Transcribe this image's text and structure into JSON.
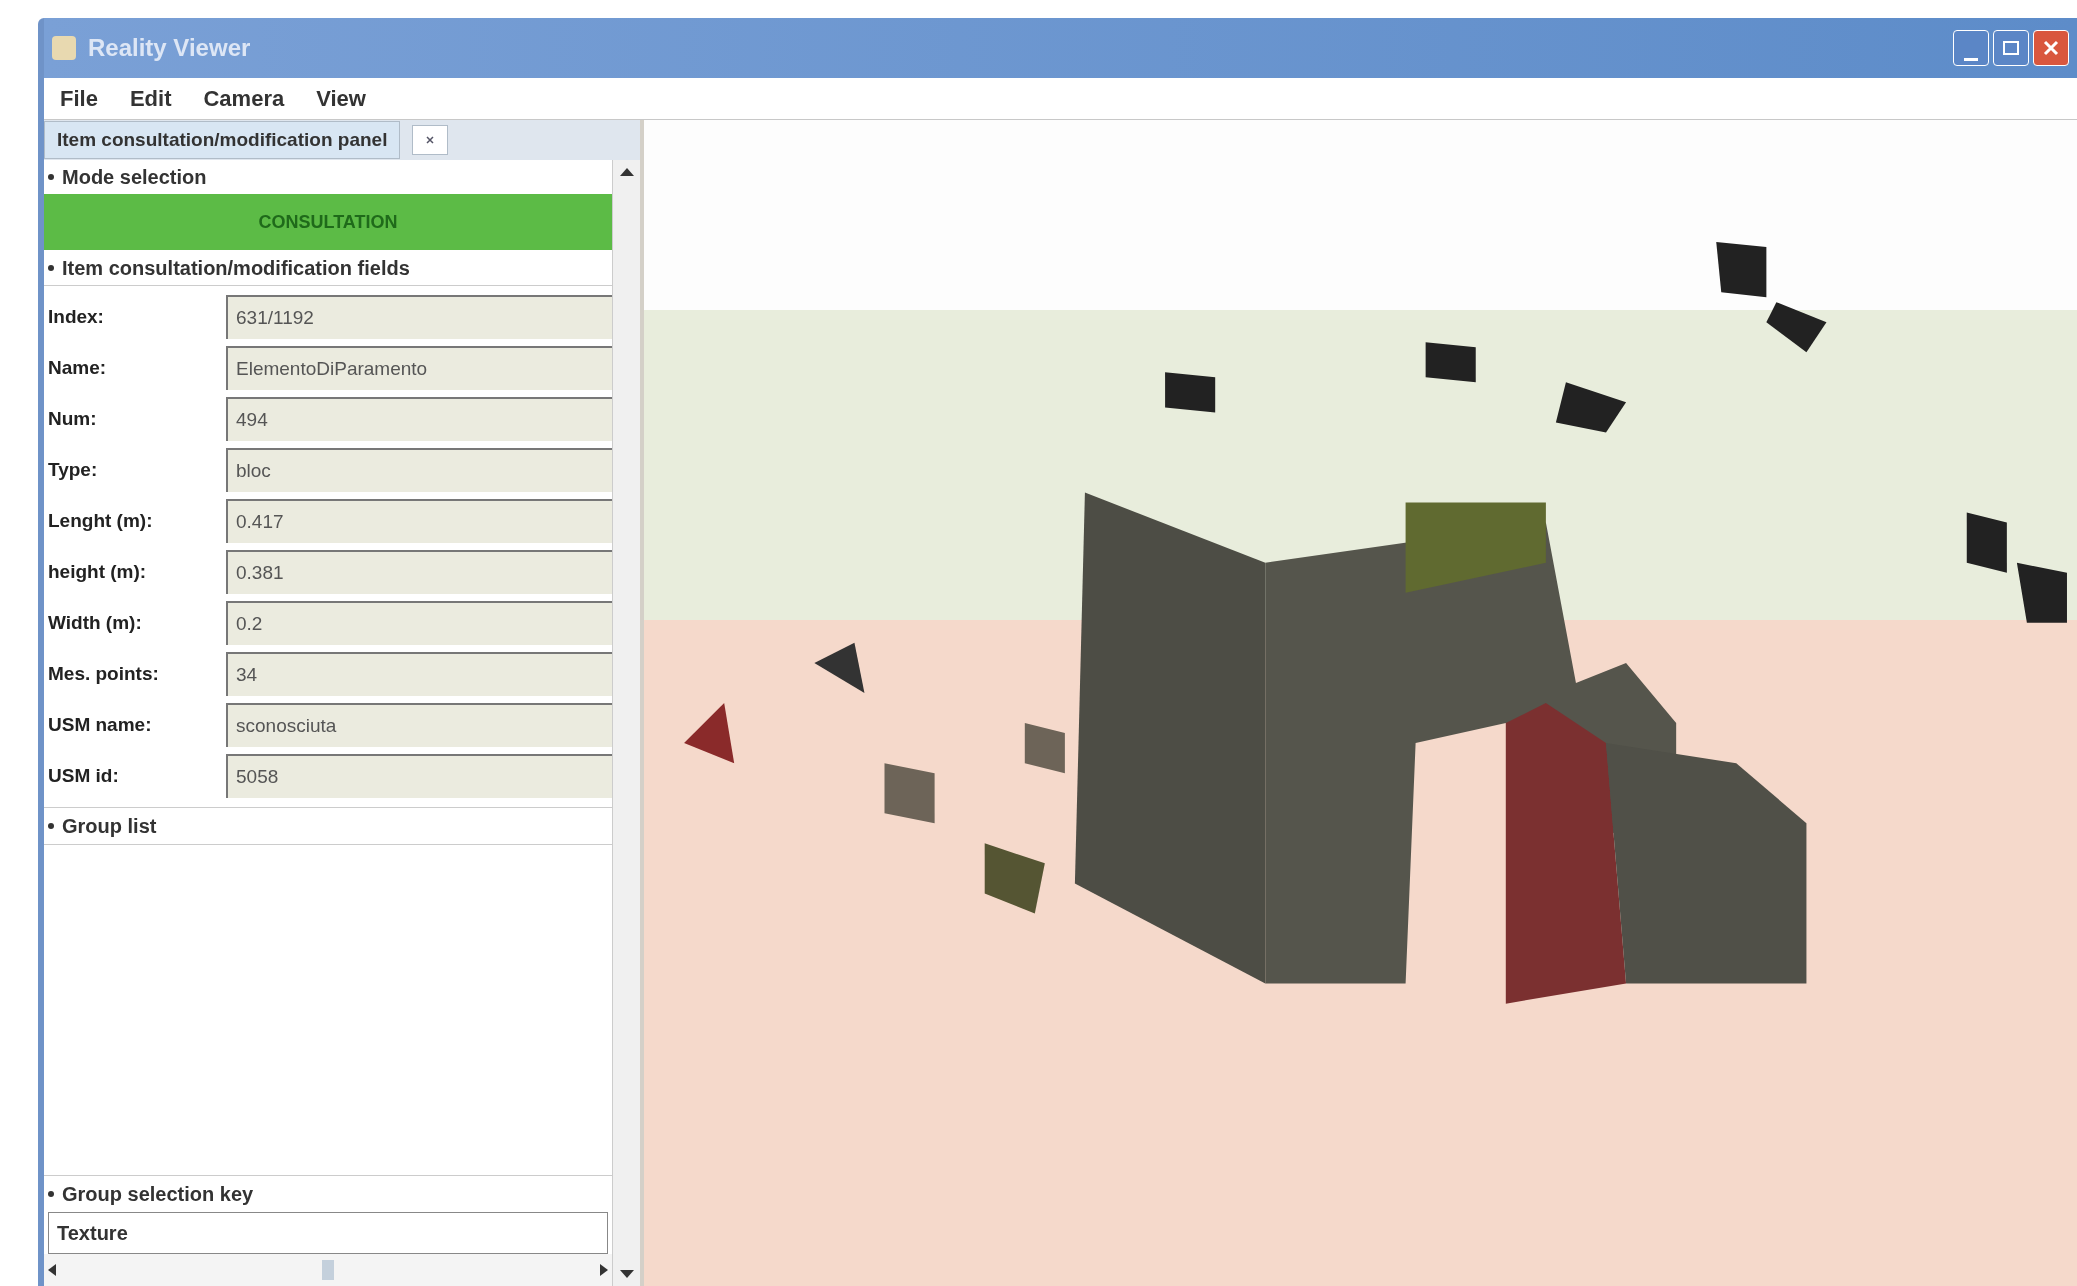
{
  "window": {
    "title": "Reality Viewer"
  },
  "menu": [
    {
      "label": "File",
      "selected": false
    },
    {
      "label": "Edit",
      "selected": false
    },
    {
      "label": "Camera",
      "selected": false
    },
    {
      "label": "View",
      "selected": false
    }
  ],
  "panel": {
    "tab": "Item consultation/modification panel",
    "mode_section": "Mode selection",
    "mode_button": "CONSULTATION",
    "fields_section": "Item consultation/modification fields",
    "fields": [
      {
        "label": "Index:",
        "value": "631/1192"
      },
      {
        "label": "Name:",
        "value": "ElementoDiParamento"
      },
      {
        "label": "Num:",
        "value": "494"
      },
      {
        "label": "Type:",
        "value": "bloc"
      },
      {
        "label": "Lenght (m):",
        "value": "0.417"
      },
      {
        "label": "height (m):",
        "value": "0.381"
      },
      {
        "label": "Width (m):",
        "value": "0.2"
      },
      {
        "label": "Mes. points:",
        "value": "34"
      },
      {
        "label": "USM name:",
        "value": "sconosciuta"
      },
      {
        "label": "USM id:",
        "value": "5058"
      }
    ],
    "group_list_section": "Group list",
    "group_key_section": "Group selection key",
    "group_key_value": "Texture"
  }
}
